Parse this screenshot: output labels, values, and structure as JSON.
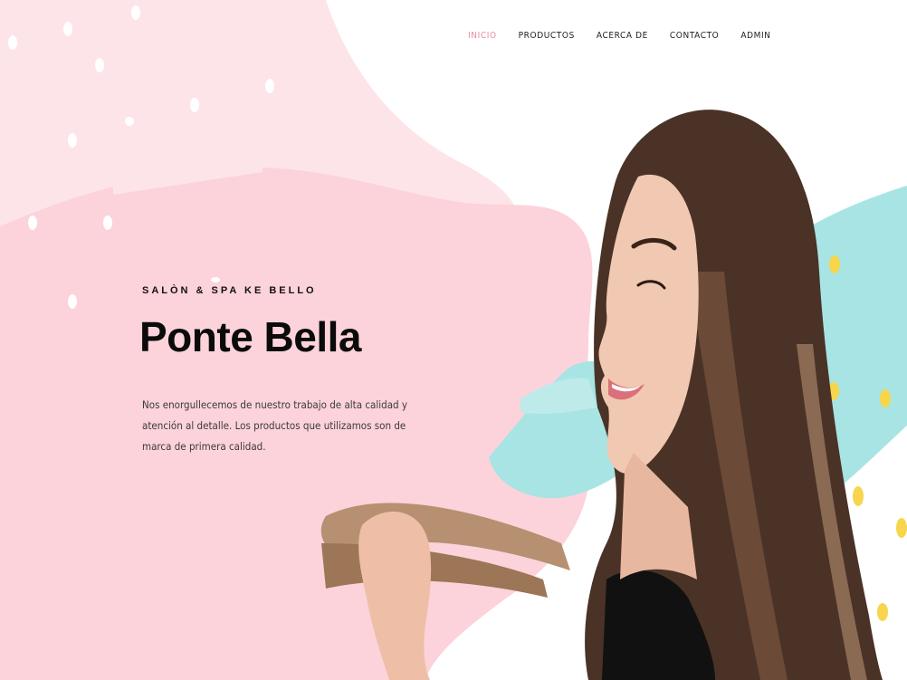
{
  "nav": {
    "items": [
      {
        "label": "INICIO",
        "active": true
      },
      {
        "label": "PRODUCTOS",
        "active": false
      },
      {
        "label": "ACERCA DE",
        "active": false
      },
      {
        "label": "CONTACTO",
        "active": false
      },
      {
        "label": "ADMIN",
        "active": false
      }
    ]
  },
  "hero": {
    "eyebrow": "SALÒN & SPA KE BELLO",
    "title": "Ponte Bella",
    "description": "Nos enorgullecemos de nuestro trabajo de alta calidad y atención al detalle. Los productos que utilizamos son de marca de primera calidad."
  },
  "colors": {
    "pink_light": "#fde4e8",
    "pink": "#fcd3da",
    "teal": "#a8e4e4",
    "yellow": "#f7d54c",
    "nav_active": "#e88ba0",
    "text_dark": "#0b0b0b"
  }
}
